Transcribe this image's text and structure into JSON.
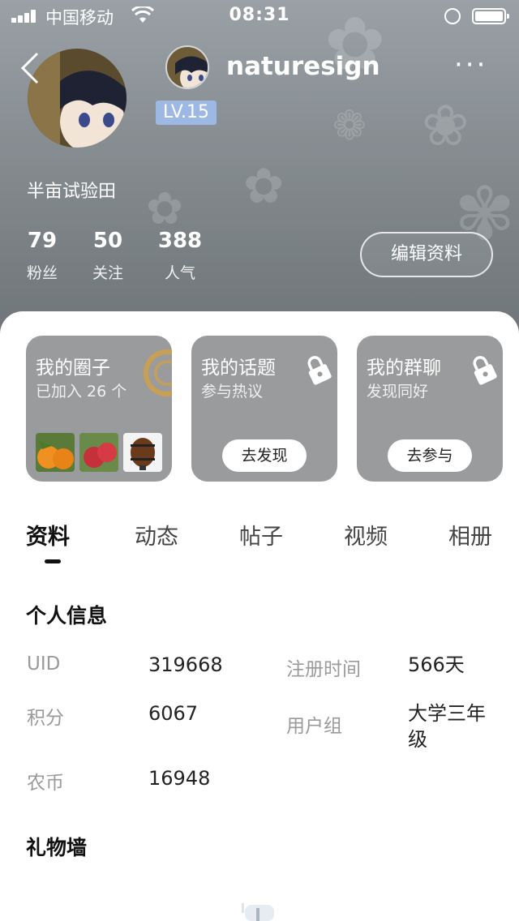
{
  "status_bar": {
    "carrier": "中国移动",
    "time": "08:31",
    "icons": [
      "signal-icon",
      "wifi-icon",
      "rotation-lock-icon",
      "battery-icon"
    ]
  },
  "nav": {
    "back_icon": "chevron-left-icon",
    "username": "naturesign",
    "more_icon": "more-dots-icon"
  },
  "profile": {
    "level": "LV.15",
    "signature": "半亩试验田",
    "stats": [
      {
        "value": "79",
        "label": "粉丝"
      },
      {
        "value": "50",
        "label": "关注"
      },
      {
        "value": "388",
        "label": "人气"
      }
    ],
    "edit_button": "编辑资料"
  },
  "cards": [
    {
      "title": "我的圈子",
      "subtitle": "已加入 26 个",
      "icon": "circle-ring-icon"
    },
    {
      "title": "我的话题",
      "subtitle": "参与热议",
      "icon": "lock-icon",
      "button": "去发现"
    },
    {
      "title": "我的群聊",
      "subtitle": "发现同好",
      "icon": "lock-icon",
      "button": "去参与"
    }
  ],
  "tabs": [
    {
      "label": "资料",
      "active": true
    },
    {
      "label": "动态",
      "active": false
    },
    {
      "label": "帖子",
      "active": false
    },
    {
      "label": "视频",
      "active": false
    },
    {
      "label": "相册",
      "active": false
    }
  ],
  "personal_info": {
    "title": "个人信息",
    "fields": [
      {
        "label": "UID",
        "value": "319668"
      },
      {
        "label": "注册时间",
        "value": "566天"
      },
      {
        "label": "积分",
        "value": "6067"
      },
      {
        "label": "用户组",
        "value": "大学三年级"
      },
      {
        "label": "农币",
        "value": "16948"
      }
    ]
  },
  "gift_wall": {
    "title": "礼物墙",
    "icon": "mailbox-icon"
  },
  "colors": {
    "level_badge": "#9eb8e4",
    "card_bg": "#999b9c",
    "ring_accent": "#c8a055"
  }
}
